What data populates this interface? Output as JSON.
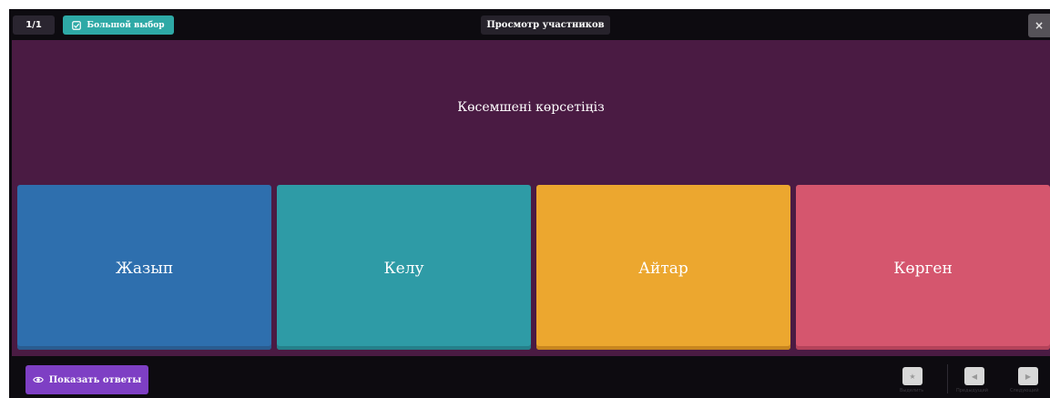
{
  "topbar": {
    "page_counter": "1/1",
    "question_type": "Большой выбор",
    "participants_label": "Просмотр участников",
    "close_symbol": "×"
  },
  "question": {
    "text": "Көсемшені көрсетіңіз",
    "background": "#4a1b43"
  },
  "answers": [
    {
      "label": "Жазып",
      "color": "#2e6fae",
      "edge": "#2a5c90"
    },
    {
      "label": "Келу",
      "color": "#2e9ba6",
      "edge": "#25808a"
    },
    {
      "label": "Айтар",
      "color": "#eca72f",
      "edge": "#c8861f"
    },
    {
      "label": "Көрген",
      "color": "#d5566e",
      "edge": "#b4435a"
    }
  ],
  "bottom": {
    "show_answers_label": "Показать ответы",
    "controls": [
      {
        "name": "highlight",
        "icon": "trophy-icon",
        "label": "Выделить"
      },
      {
        "name": "previous",
        "icon": "prev-arrow-icon",
        "label": "Предыдущий"
      },
      {
        "name": "next",
        "icon": "next-arrow-icon",
        "label": "Следующий"
      }
    ]
  },
  "colors": {
    "frame": "#0d0b10",
    "accent_teal": "#2ea9a6",
    "accent_purple": "#7e3fc4"
  }
}
